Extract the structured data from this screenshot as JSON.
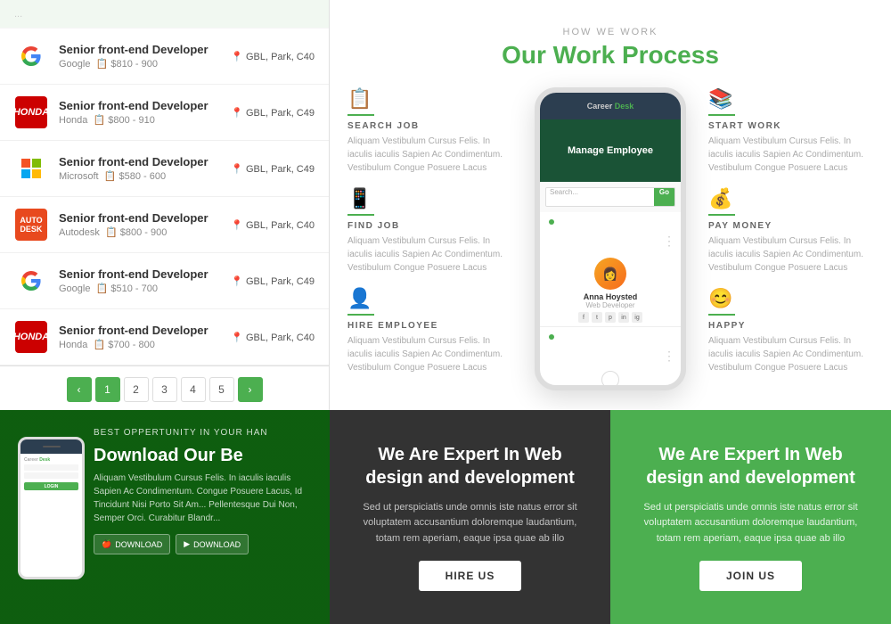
{
  "jobs": [
    {
      "id": 1,
      "title": "Senior front-end Developer",
      "company": "Google",
      "location": "GBL, Park, C40",
      "salary": "$810 - 900",
      "logoType": "google"
    },
    {
      "id": 2,
      "title": "Senior front-end Developer",
      "company": "Honda",
      "location": "GBL, Park, C49",
      "salary": "$800 - 910",
      "logoType": "honda"
    },
    {
      "id": 3,
      "title": "Senior front-end Developer",
      "company": "Microsoft",
      "location": "GBL, Park, C49",
      "salary": "$580 - 600",
      "logoType": "microsoft"
    },
    {
      "id": 4,
      "title": "Senior front-end Developer",
      "company": "Autodesk",
      "location": "GBL, Park, C40",
      "salary": "$800 - 900",
      "logoType": "autodesk"
    },
    {
      "id": 5,
      "title": "Senior front-end Developer",
      "company": "Google",
      "location": "GBL, Park, C49",
      "salary": "$510 - 700",
      "logoType": "google"
    },
    {
      "id": 6,
      "title": "Senior front-end Developer",
      "company": "Honda",
      "location": "GBL, Park, C40",
      "salary": "$700 - 800",
      "logoType": "honda"
    }
  ],
  "pagination": {
    "prev": "‹",
    "pages": [
      "1",
      "2",
      "3",
      "4",
      "5"
    ],
    "next": "›",
    "active": "1"
  },
  "how_we_work": {
    "label": "HOW WE WORK",
    "title_plain": "Our Work ",
    "title_green": "Process",
    "steps_left": [
      {
        "icon": "📋",
        "title": "SEARCH JOB",
        "desc": "Aliquam Vestibulum Cursus Felis. In iaculis iaculis Sapien Ac Condimentum. Vestibulum Congue Posuere Lacus"
      },
      {
        "icon": "📱",
        "title": "FIND JOB",
        "desc": "Aliquam Vestibulum Cursus Felis. In iaculis iaculis Sapien Ac Condimentum. Vestibulum Congue Posuere Lacus"
      },
      {
        "icon": "👤",
        "title": "HIRE EMPLOYEE",
        "desc": "Aliquam Vestibulum Cursus Felis. In iaculis iaculis Sapien Ac Condimentum. Vestibulum Congue Posuere Lacus"
      }
    ],
    "steps_right": [
      {
        "icon": "📚",
        "title": "START WORK",
        "desc": "Aliquam Vestibulum Cursus Felis. In iaculis iaculis Sapien Ac Condimentum. Vestibulum Congue Posuere Lacus"
      },
      {
        "icon": "💰",
        "title": "PAY MONEY",
        "desc": "Aliquam Vestibulum Cursus Felis. In iaculis iaculis Sapien Ac Condimentum. Vestibulum Congue Posuere Lacus"
      },
      {
        "icon": "😊",
        "title": "HAPPY",
        "desc": "Aliquam Vestibulum Cursus Felis. In iaculis iaculis Sapien Ac Condimentum. Vestibulum Congue Posuere Lacus"
      }
    ],
    "phone": {
      "app_name_part1": "Career",
      "app_name_part2": "Desk",
      "banner_text": "Manage Employee",
      "search_placeholder": "Search...",
      "search_btn": "Go",
      "profile_name": "Anna Hoysted",
      "profile_role": "Web Developer"
    }
  },
  "download_section": {
    "title": "Download Our Be",
    "subtitle": "BEST OPPERTUNITY IN YOUR HAN",
    "desc": "Aliquam Vestibulum Cursus Felis. In iaculis iaculis Sapien Ac Condimentum. Congue Posuere Lacus, Id Tincidunt Nisi Porto Sit Am... Pellentesque Dui Non, Semper Orci. Curabitur Blandr...",
    "btn1": "DOWNLOAD",
    "btn2": "DOWNLOAD"
  },
  "cta_center": {
    "title": "We Are Expert In Web design and development",
    "desc": "Sed ut perspiciatis unde omnis iste natus error sit voluptatem accusantium doloremque laudantium, totam rem aperiam, eaque ipsa quae ab illo",
    "btn_label": "HIRE US"
  },
  "cta_right": {
    "title": "We Are Expert In Web design and development",
    "desc": "Sed ut perspiciatis unde omnis iste natus error sit voluptatem accusantium doloremque laudantium, totam rem aperiam, eaque ipsa quae ab illo",
    "btn_label": "JOIN US"
  }
}
